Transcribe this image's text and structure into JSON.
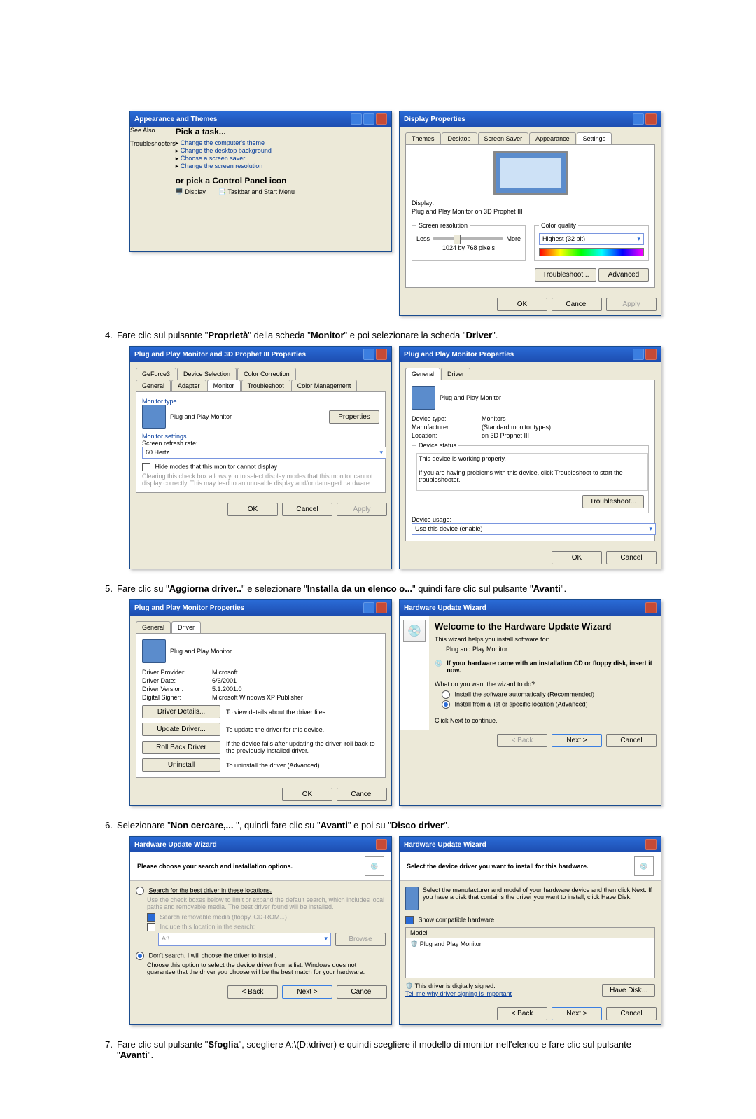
{
  "display_props": {
    "title": "Display Properties",
    "tabs": [
      "Themes",
      "Desktop",
      "Screen Saver",
      "Appearance",
      "Settings"
    ],
    "active_tab": "Settings",
    "display_label": "Display:",
    "display_value": "Plug and Play Monitor on 3D Prophet III",
    "screen_res_label": "Screen resolution",
    "less": "Less",
    "more": "More",
    "res_value": "1024 by 768 pixels",
    "color_quality_label": "Color quality",
    "color_quality_value": "Highest (32 bit)",
    "troubleshoot_btn": "Troubleshoot...",
    "advanced_btn": "Advanced",
    "ok": "OK",
    "cancel": "Cancel",
    "apply": "Apply"
  },
  "control_panel": {
    "title": "Appearance and Themes",
    "see_also": "See Also",
    "pick_task": "Pick a task...",
    "tasks": [
      "Change the computer's theme",
      "Change the desktop background",
      "Choose a screen saver",
      "Change the screen resolution"
    ],
    "or_pick": "or pick a Control Panel icon",
    "icon_display": "Display",
    "icon_other": "Taskbar and Start Menu",
    "troubleshoot_nav": "Troubleshooters"
  },
  "step4": {
    "num": "4.",
    "text_1": "Fare clic sul pulsante \"",
    "bold_1": "Proprietà",
    "text_2": "\" della scheda \"",
    "bold_2": "Monitor",
    "text_3": "\" e poi selezionare la scheda \"",
    "bold_3": "Driver",
    "text_4": "\"."
  },
  "prophet_props": {
    "title": "Plug and Play Monitor and 3D Prophet III Properties",
    "tabs_row1": [
      "GeForce3",
      "Device Selection",
      "Color Correction"
    ],
    "tabs_row2": [
      "General",
      "Adapter",
      "Monitor",
      "Troubleshoot",
      "Color Management"
    ],
    "active_tab": "Monitor",
    "monitor_type_label": "Monitor type",
    "monitor_type_value": "Plug and Play Monitor",
    "properties_btn": "Properties",
    "monitor_settings_label": "Monitor settings",
    "refresh_label": "Screen refresh rate:",
    "refresh_value": "60 Hertz",
    "hide_modes_chk": "Hide modes that this monitor cannot display",
    "hide_modes_expl": "Clearing this check box allows you to select display modes that this monitor cannot display correctly. This may lead to an unusable display and/or damaged hardware.",
    "ok": "OK",
    "cancel": "Cancel",
    "apply": "Apply"
  },
  "pp_monitor_props_general": {
    "title": "Plug and Play Monitor Properties",
    "tabs": [
      "General",
      "Driver"
    ],
    "active_tab": "General",
    "name": "Plug and Play Monitor",
    "device_type_l": "Device type:",
    "device_type_v": "Monitors",
    "manufacturer_l": "Manufacturer:",
    "manufacturer_v": "(Standard monitor types)",
    "location_l": "Location:",
    "location_v": "on 3D Prophet III",
    "device_status_l": "Device status",
    "status_line1": "This device is working properly.",
    "status_line2": "If you are having problems with this device, click Troubleshoot to start the troubleshooter.",
    "troubleshoot_btn": "Troubleshoot...",
    "device_usage_l": "Device usage:",
    "device_usage_v": "Use this device (enable)",
    "ok": "OK",
    "cancel": "Cancel"
  },
  "step5": {
    "num": "5.",
    "text_1": "Fare clic su \"",
    "bold_1": "Aggiorna driver..",
    "text_2": "\" e selezionare \"",
    "bold_2": "Installa da un elenco o...",
    "text_3": "\" quindi fare clic sul pulsante \"",
    "bold_3": "Avanti",
    "text_4": "\"."
  },
  "pp_monitor_props_driver": {
    "title": "Plug and Play Monitor Properties",
    "tabs": [
      "General",
      "Driver"
    ],
    "active_tab": "Driver",
    "name": "Plug and Play Monitor",
    "provider_l": "Driver Provider:",
    "provider_v": "Microsoft",
    "date_l": "Driver Date:",
    "date_v": "6/6/2001",
    "version_l": "Driver Version:",
    "version_v": "5.1.2001.0",
    "signer_l": "Digital Signer:",
    "signer_v": "Microsoft Windows XP Publisher",
    "details_btn": "Driver Details...",
    "details_desc": "To view details about the driver files.",
    "update_btn": "Update Driver...",
    "update_desc": "To update the driver for this device.",
    "rollback_btn": "Roll Back Driver",
    "rollback_desc": "If the device fails after updating the driver, roll back to the previously installed driver.",
    "uninstall_btn": "Uninstall",
    "uninstall_desc": "To uninstall the driver (Advanced).",
    "ok": "OK",
    "cancel": "Cancel"
  },
  "hwwiz_welcome": {
    "title": "Hardware Update Wizard",
    "heading": "Welcome to the Hardware Update Wizard",
    "intro": "This wizard helps you install software for:",
    "device": "Plug and Play Monitor",
    "hint": "If your hardware came with an installation CD or floppy disk, insert it now.",
    "question": "What do you want the wizard to do?",
    "opt_auto": "Install the software automatically (Recommended)",
    "opt_list": "Install from a list or specific location (Advanced)",
    "continue": "Click Next to continue.",
    "back": "< Back",
    "next": "Next >",
    "cancel": "Cancel"
  },
  "step6": {
    "num": "6.",
    "text_1": "Selezionare \"",
    "bold_1": "Non cercare,... ",
    "text_2": "\", quindi fare clic su \"",
    "bold_2": "Avanti",
    "text_3": "\" e poi su \"",
    "bold_3": "Disco driver",
    "text_4": "\"."
  },
  "hwwiz_search": {
    "title": "Hardware Update Wizard",
    "heading": "Please choose your search and installation options.",
    "opt_search": "Search for the best driver in these locations.",
    "search_expl": "Use the check boxes below to limit or expand the default search, which includes local paths and removable media. The best driver found will be installed.",
    "chk_removable": "Search removable media (floppy, CD-ROM...)",
    "chk_include": "Include this location in the search:",
    "path_value": "A:\\",
    "browse_btn": "Browse",
    "opt_dont": "Don't search. I will choose the driver to install.",
    "dont_expl": "Choose this option to select the device driver from a list. Windows does not guarantee that the driver you choose will be the best match for your hardware.",
    "back": "< Back",
    "next": "Next >",
    "cancel": "Cancel"
  },
  "hwwiz_select": {
    "title": "Hardware Update Wizard",
    "heading": "Select the device driver you want to install for this hardware.",
    "desc": "Select the manufacturer and model of your hardware device and then click Next. If you have a disk that contains the driver you want to install, click Have Disk.",
    "chk_compat": "Show compatible hardware",
    "model_l": "Model",
    "model_item": "Plug and Play Monitor",
    "signed_msg": "This driver is digitally signed.",
    "why_link": "Tell me why driver signing is important",
    "have_disk_btn": "Have Disk...",
    "back": "< Back",
    "next": "Next >",
    "cancel": "Cancel"
  },
  "step7": {
    "num": "7.",
    "text_1": "Fare clic sul pulsante \"",
    "bold_1": "Sfoglia",
    "text_2": "\", scegliere A:\\(D:\\driver) e quindi scegliere il modello di monitor nell'elenco e fare clic sul pulsante \"",
    "bold_2": "Avanti",
    "text_3": "\"."
  }
}
